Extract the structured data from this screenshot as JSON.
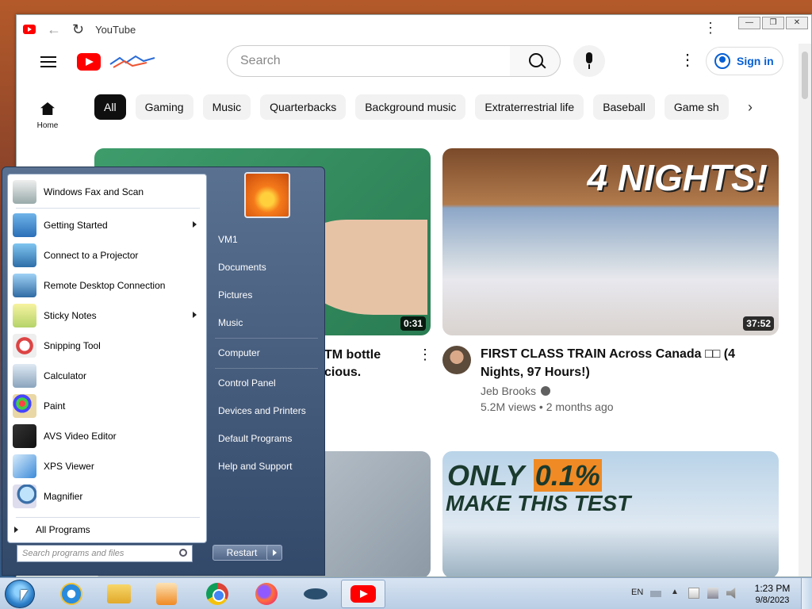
{
  "browser": {
    "tab_title": "YouTube",
    "window_buttons": [
      "—",
      "❐",
      "✕"
    ]
  },
  "youtube": {
    "search_placeholder": "Search",
    "sign_in_label": "Sign in",
    "chips": [
      "All",
      "Gaming",
      "Music",
      "Quarterbacks",
      "Background music",
      "Extraterrestrial life",
      "Baseball",
      "Game sh"
    ],
    "sidebar_home_label": "Home",
    "videos": [
      {
        "title_fragment": "TM bottle\ncious.",
        "duration": "0:31"
      },
      {
        "title": "FIRST CLASS TRAIN Across Canada □□ (4 Nights, 97 Hours!)",
        "channel": "Jeb Brooks",
        "meta": "5.2M views • 2 months ago",
        "duration": "37:52",
        "thumb_text": "4 NIGHTS!"
      },
      {
        "thumb_text_line1_prefix": "ONLY ",
        "thumb_text_line1_highlight": "0.1%",
        "thumb_text_line2": "MAKE THIS TEST"
      }
    ]
  },
  "start_menu": {
    "programs": [
      {
        "label": "Windows Fax and Scan",
        "icon": "fax-icon",
        "has_submenu": false
      },
      {
        "label": "Getting Started",
        "icon": "getting-started-icon",
        "has_submenu": true
      },
      {
        "label": "Connect to a Projector",
        "icon": "projector-icon",
        "has_submenu": false
      },
      {
        "label": "Remote Desktop Connection",
        "icon": "remote-desktop-icon",
        "has_submenu": false
      },
      {
        "label": "Sticky Notes",
        "icon": "sticky-notes-icon",
        "has_submenu": true
      },
      {
        "label": "Snipping Tool",
        "icon": "snipping-tool-icon",
        "has_submenu": false
      },
      {
        "label": "Calculator",
        "icon": "calculator-icon",
        "has_submenu": false
      },
      {
        "label": "Paint",
        "icon": "paint-icon",
        "has_submenu": false
      },
      {
        "label": "AVS Video Editor",
        "icon": "video-editor-icon",
        "has_submenu": false
      },
      {
        "label": "XPS Viewer",
        "icon": "xps-viewer-icon",
        "has_submenu": false
      },
      {
        "label": "Magnifier",
        "icon": "magnifier-icon",
        "has_submenu": false
      }
    ],
    "all_programs_label": "All Programs",
    "search_placeholder": "Search programs and files",
    "right_items": [
      "VM1",
      "Documents",
      "Pictures",
      "Music",
      "Computer",
      "Control Panel",
      "Devices and Printers",
      "Default Programs",
      "Help and Support"
    ],
    "restart_label": "Restart"
  },
  "taskbar": {
    "language": "EN",
    "time": "1:23 PM",
    "date": "9/8/2023"
  },
  "colors": {
    "youtube_red": "#ff0000",
    "link_blue": "#065fd4",
    "start_menu_blue": "#33496a"
  }
}
